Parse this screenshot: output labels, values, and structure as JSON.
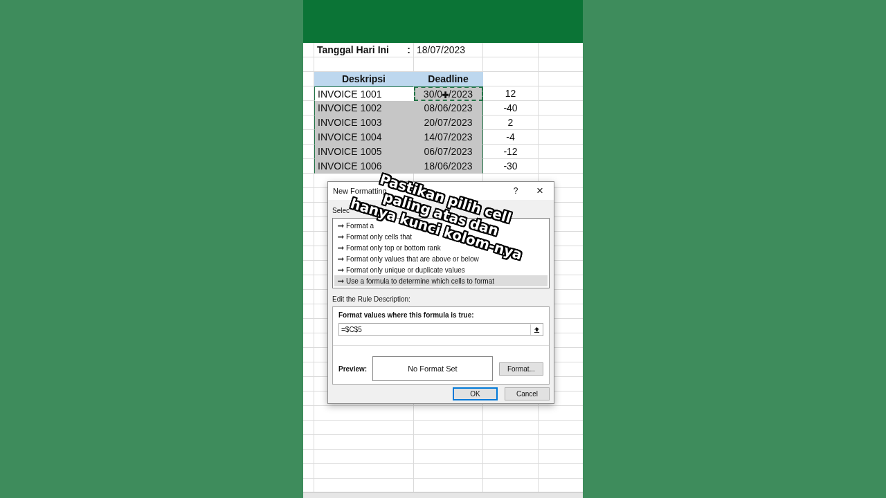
{
  "sheet": {
    "date_row": {
      "label": "Tanggal Hari Ini",
      "separator": ":",
      "value": "18/07/2023"
    },
    "headers": [
      "Deskripsi",
      "Deadline"
    ],
    "rows": [
      {
        "description": "INVOICE 1001",
        "deadline": "30/0",
        "deadline_tail": "/2023",
        "days": "12",
        "active": true
      },
      {
        "description": "INVOICE 1002",
        "deadline": "08/06/2023",
        "days": "-40",
        "active": false
      },
      {
        "description": "INVOICE 1003",
        "deadline": "20/07/2023",
        "days": "2",
        "active": false
      },
      {
        "description": "INVOICE 1004",
        "deadline": "14/07/2023",
        "days": "-4",
        "active": false
      },
      {
        "description": "INVOICE 1005",
        "deadline": "06/07/2023",
        "days": "-12",
        "active": false
      },
      {
        "description": "INVOICE 1006",
        "deadline": "18/06/2023",
        "days": "-30",
        "active": false
      }
    ]
  },
  "dialog": {
    "title": "New Formatting",
    "help": "?",
    "close": "×",
    "rule_type_label": "Selec",
    "rule_types": [
      {
        "label": "Format a",
        "selected": false
      },
      {
        "label": "Format only cells that",
        "selected": false
      },
      {
        "label": "Format only top or bottom rank",
        "selected": false
      },
      {
        "label": "Format only values that are above or below",
        "selected": false
      },
      {
        "label": "Format only unique or duplicate values",
        "selected": false
      },
      {
        "label": "Use a formula to determine which cells to format",
        "selected": true
      }
    ],
    "description_label": "Edit the Rule Description:",
    "formula_label": "Format values where this formula is true:",
    "formula_value": "=$C$5",
    "preview_label": "Preview:",
    "preview_text": "No Format Set",
    "format_button": "Format...",
    "ok_button": "OK",
    "cancel_button": "Cancel"
  },
  "overlay_caption": [
    "Pastikan pilih cell",
    "paling atas dan",
    "hanya kunci kolom-nya"
  ]
}
